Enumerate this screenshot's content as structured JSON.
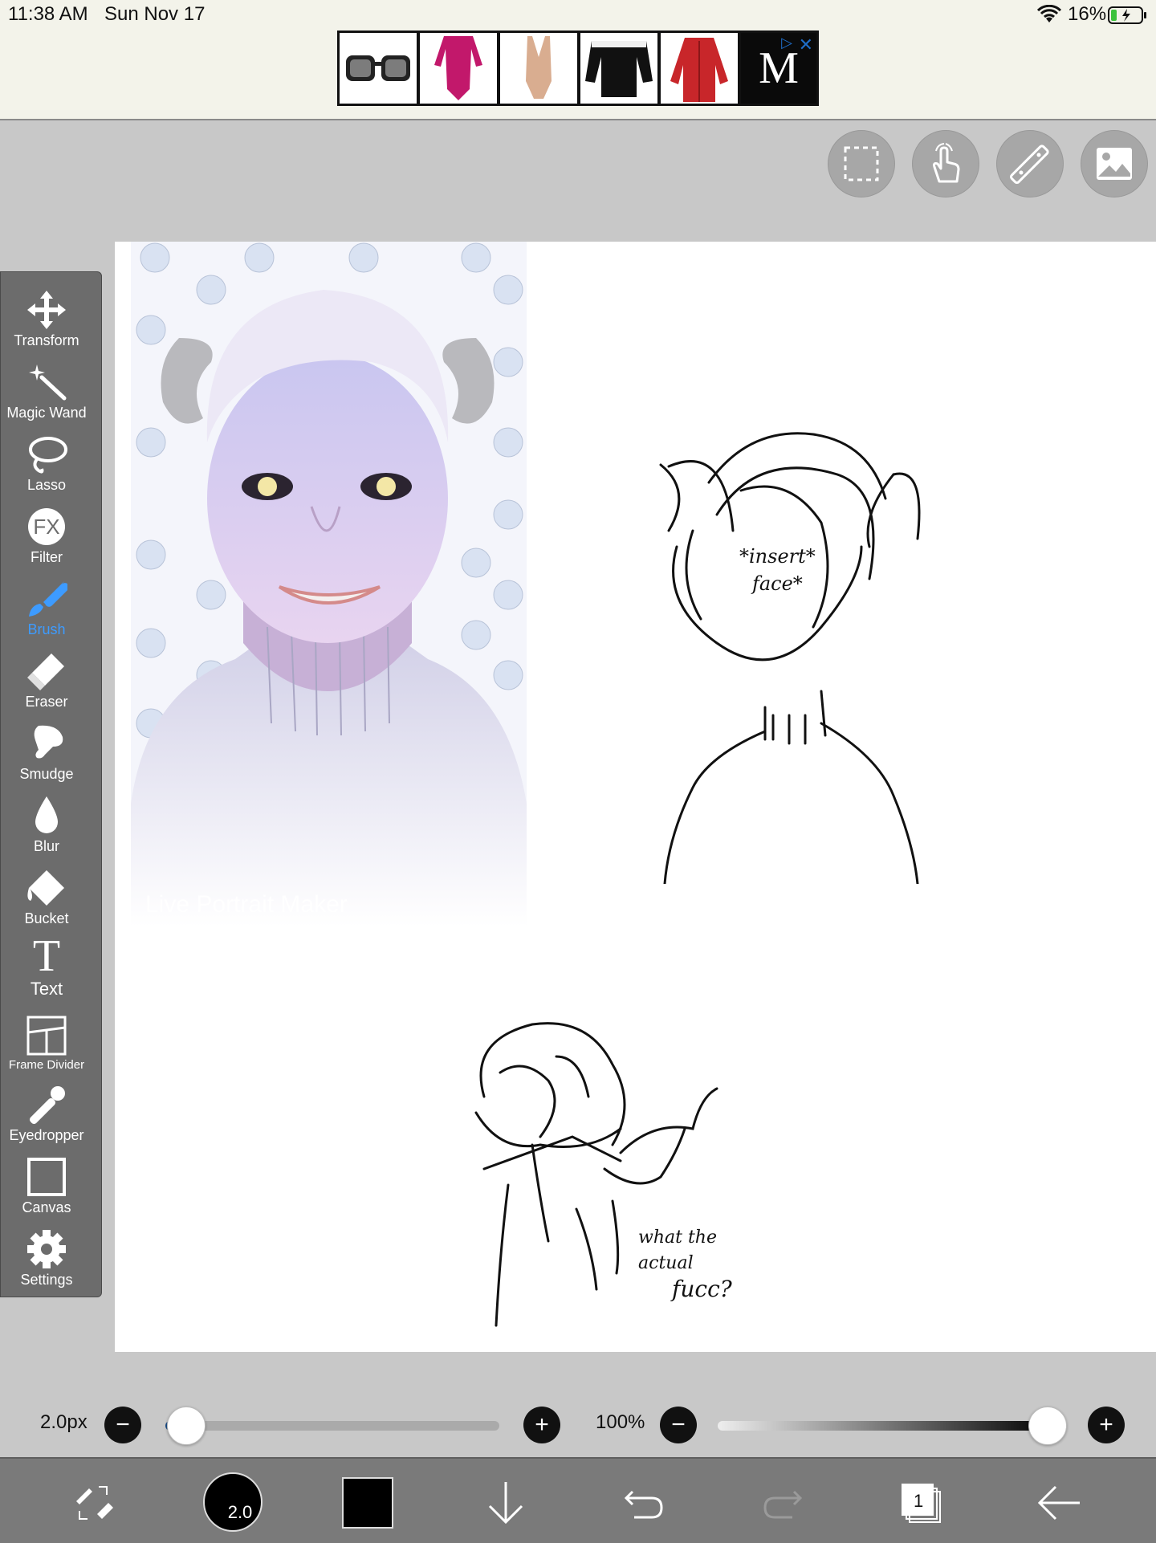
{
  "status_bar": {
    "time": "11:38 AM",
    "date": "Sun Nov 17",
    "battery": "16%"
  },
  "ad": {
    "logo": "M",
    "close_icon": "close-icon",
    "adchoices_icon": "adchoices-icon"
  },
  "top_buttons": [
    {
      "name": "selection-button",
      "icon": "dashed-select-icon"
    },
    {
      "name": "hand-button",
      "icon": "hand-icon"
    },
    {
      "name": "ruler-button",
      "icon": "ruler-icon"
    },
    {
      "name": "material-button",
      "icon": "image-icon"
    }
  ],
  "tools": [
    {
      "label": "Transform",
      "icon": "move-arrows-icon"
    },
    {
      "label": "Magic Wand",
      "icon": "magic-wand-icon"
    },
    {
      "label": "Lasso",
      "icon": "lasso-icon"
    },
    {
      "label": "Filter",
      "icon": "fx-icon",
      "icon_text": "FX"
    },
    {
      "label": "Brush",
      "icon": "brush-icon",
      "active": true
    },
    {
      "label": "Eraser",
      "icon": "eraser-icon"
    },
    {
      "label": "Smudge",
      "icon": "smudge-icon"
    },
    {
      "label": "Blur",
      "icon": "droplet-icon"
    },
    {
      "label": "Bucket",
      "icon": "bucket-icon"
    },
    {
      "label": "Text",
      "icon": "text-icon",
      "icon_text": "T"
    },
    {
      "label": "Frame Divider",
      "icon": "frame-divider-icon"
    },
    {
      "label": "Eyedropper",
      "icon": "eyedropper-icon"
    },
    {
      "label": "Canvas",
      "icon": "canvas-icon"
    },
    {
      "label": "Settings",
      "icon": "gear-icon"
    }
  ],
  "canvas": {
    "portrait_watermark": "Live Portrait Maker",
    "sketch1_text": [
      "*insert*",
      "face*"
    ],
    "sketch2_text": [
      "what the",
      "actual",
      "fucc?"
    ]
  },
  "sliders": {
    "size_label": "2.0px",
    "size_fraction": 0.06,
    "opacity_label": "100%",
    "opacity_fraction": 1.0
  },
  "bottom_bar": {
    "brush_size": "2.0",
    "color": "#000000",
    "layer_count": "1"
  },
  "colors": {
    "accent": "#3d9bff",
    "toolbar": "#6c6c6c",
    "bottom": "#7a7a7a"
  }
}
